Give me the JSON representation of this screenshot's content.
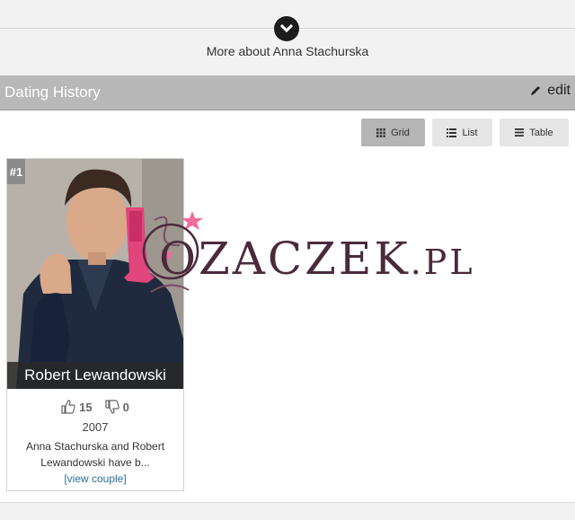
{
  "header": {
    "more_label": "More about Anna Stachurska",
    "expand_icon": "chevron-down-icon"
  },
  "section": {
    "title": "Dating History",
    "edit_label": "edit"
  },
  "view_toggle": {
    "grid": "Grid",
    "list": "List",
    "table": "Table",
    "active": "Grid"
  },
  "cards": [
    {
      "rank": "#1",
      "name": "Robert Lewandowski",
      "likes": "15",
      "dislikes": "0",
      "year": "2007",
      "description": "Anna Stachurska and Robert Lewandowski have b...",
      "link": "[view couple]"
    }
  ],
  "watermark": {
    "text": "OZACZEK",
    "suffix": ".PL",
    "colors": {
      "boot": "#e0457b",
      "star": "#f06a9a",
      "text": "#4b2a3c"
    }
  }
}
